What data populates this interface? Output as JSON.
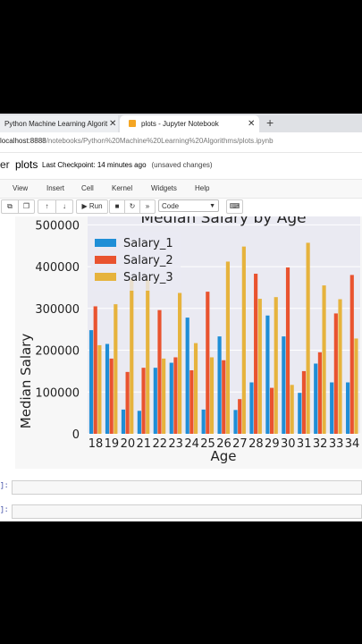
{
  "browser": {
    "tabs": [
      {
        "label": "Python Machine Learning Algorit",
        "close": "✕"
      },
      {
        "label": "plots - Jupyter Notebook",
        "close": "✕"
      }
    ],
    "new_tab": "+",
    "url_host": "localhost:8888",
    "url_path": "/notebooks/Python%20Machine%20Learning%20Algorithms/plots.ipynb"
  },
  "notebook": {
    "logo_fragment": "er",
    "title": "plots",
    "checkpoint": "Last Checkpoint: 14 minutes ago",
    "status": "(unsaved changes)",
    "menu": [
      "View",
      "Insert",
      "Cell",
      "Kernel",
      "Widgets",
      "Help"
    ],
    "toolbar": {
      "run_label": "Run",
      "cell_type": "Code"
    },
    "prompts": [
      "]:",
      "]:"
    ]
  },
  "chart_data": {
    "type": "bar",
    "title": "Median Salary by Age",
    "xlabel": "Age",
    "ylabel": "Median Salary",
    "ylim": [
      0,
      520000
    ],
    "yticks": [
      "0",
      "100000",
      "200000",
      "300000",
      "400000",
      "500000"
    ],
    "grid": true,
    "legend_position": "top-left",
    "categories": [
      "18",
      "19",
      "20",
      "21",
      "22",
      "23",
      "24",
      "25",
      "26",
      "27",
      "28",
      "29",
      "30",
      "31",
      "32",
      "33",
      "34"
    ],
    "series": [
      {
        "name": "Salary_1",
        "color": "#1f8ed6",
        "values": [
          248000,
          215000,
          58000,
          55000,
          158000,
          170000,
          278000,
          58000,
          233000,
          57000,
          123000,
          283000,
          233000,
          98000,
          168000,
          123000,
          123000
        ]
      },
      {
        "name": "Salary_2",
        "color": "#e9532f",
        "values": [
          305000,
          180000,
          148000,
          158000,
          296000,
          183000,
          152000,
          340000,
          176000,
          83000,
          383000,
          110000,
          398000,
          150000,
          195000,
          288000,
          380000
        ]
      },
      {
        "name": "Salary_3",
        "color": "#e6b33d",
        "values": [
          212000,
          310000,
          370000,
          368000,
          180000,
          337000,
          217000,
          183000,
          412000,
          448000,
          323000,
          327000,
          117000,
          457000,
          355000,
          322000,
          228000
        ]
      }
    ]
  }
}
